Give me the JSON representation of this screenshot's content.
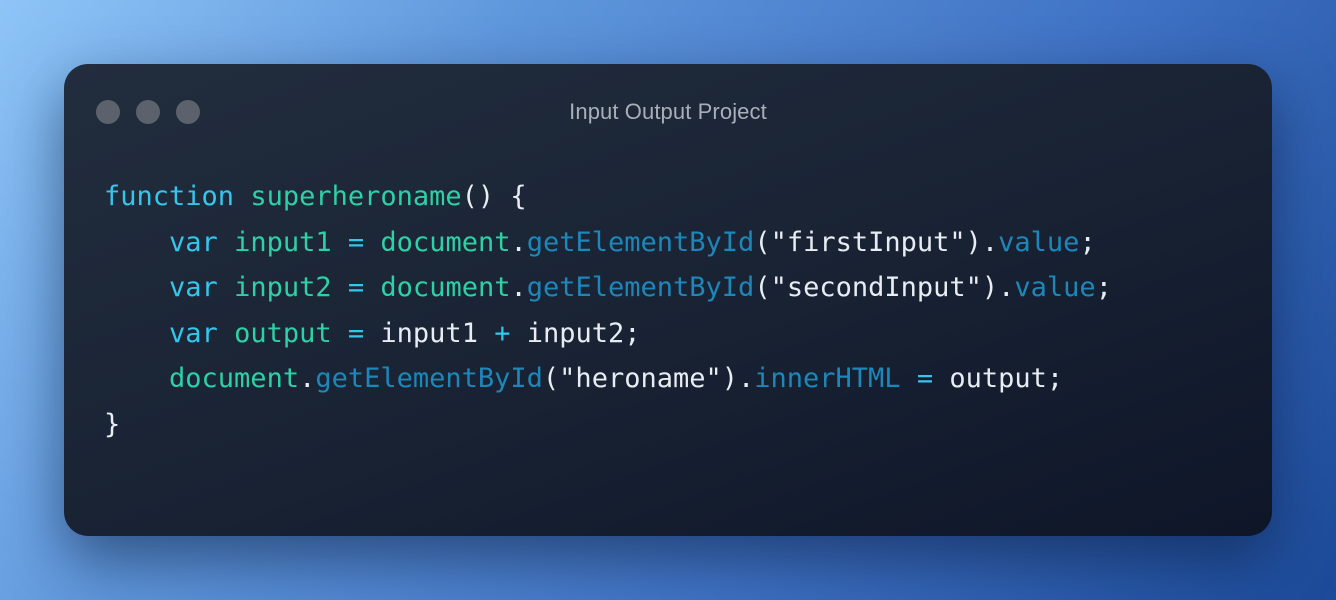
{
  "window": {
    "title": "Input Output Project",
    "dots": [
      {
        "name": "window-dot-1",
        "color": "#5b626c"
      },
      {
        "name": "window-dot-2",
        "color": "#5b626c"
      },
      {
        "name": "window-dot-3",
        "color": "#5b626c"
      }
    ]
  },
  "colors": {
    "keyword": "#35c6ec",
    "identifier": "#2ed1a6",
    "method": "#1d87b9",
    "operator": "#35c6ec",
    "plain": "#e8edf3"
  },
  "code": {
    "lines": [
      [
        {
          "t": "function",
          "k": "keyword"
        },
        {
          "t": " ",
          "k": "plain"
        },
        {
          "t": "superheroname",
          "k": "identifier"
        },
        {
          "t": "() {",
          "k": "plain"
        }
      ],
      [
        {
          "t": "    ",
          "k": "plain"
        },
        {
          "t": "var",
          "k": "keyword"
        },
        {
          "t": " ",
          "k": "plain"
        },
        {
          "t": "input1",
          "k": "identifier"
        },
        {
          "t": " ",
          "k": "plain"
        },
        {
          "t": "=",
          "k": "operator"
        },
        {
          "t": " ",
          "k": "plain"
        },
        {
          "t": "document",
          "k": "identifier"
        },
        {
          "t": ".",
          "k": "plain"
        },
        {
          "t": "getElementById",
          "k": "method"
        },
        {
          "t": "(\"firstInput\").",
          "k": "plain"
        },
        {
          "t": "value",
          "k": "method"
        },
        {
          "t": ";",
          "k": "plain"
        }
      ],
      [
        {
          "t": "    ",
          "k": "plain"
        },
        {
          "t": "var",
          "k": "keyword"
        },
        {
          "t": " ",
          "k": "plain"
        },
        {
          "t": "input2",
          "k": "identifier"
        },
        {
          "t": " ",
          "k": "plain"
        },
        {
          "t": "=",
          "k": "operator"
        },
        {
          "t": " ",
          "k": "plain"
        },
        {
          "t": "document",
          "k": "identifier"
        },
        {
          "t": ".",
          "k": "plain"
        },
        {
          "t": "getElementById",
          "k": "method"
        },
        {
          "t": "(\"secondInput\").",
          "k": "plain"
        },
        {
          "t": "value",
          "k": "method"
        },
        {
          "t": ";",
          "k": "plain"
        }
      ],
      [
        {
          "t": "    ",
          "k": "plain"
        },
        {
          "t": "var",
          "k": "keyword"
        },
        {
          "t": " ",
          "k": "plain"
        },
        {
          "t": "output",
          "k": "identifier"
        },
        {
          "t": " ",
          "k": "plain"
        },
        {
          "t": "=",
          "k": "operator"
        },
        {
          "t": " input1 ",
          "k": "plain"
        },
        {
          "t": "+",
          "k": "operator"
        },
        {
          "t": " input2;",
          "k": "plain"
        }
      ],
      [
        {
          "t": "    ",
          "k": "plain"
        },
        {
          "t": "document",
          "k": "identifier"
        },
        {
          "t": ".",
          "k": "plain"
        },
        {
          "t": "getElementById",
          "k": "method"
        },
        {
          "t": "(\"heroname\").",
          "k": "plain"
        },
        {
          "t": "innerHTML",
          "k": "method"
        },
        {
          "t": " ",
          "k": "plain"
        },
        {
          "t": "=",
          "k": "operator"
        },
        {
          "t": " output;",
          "k": "plain"
        }
      ],
      [
        {
          "t": "}",
          "k": "plain"
        }
      ]
    ]
  }
}
